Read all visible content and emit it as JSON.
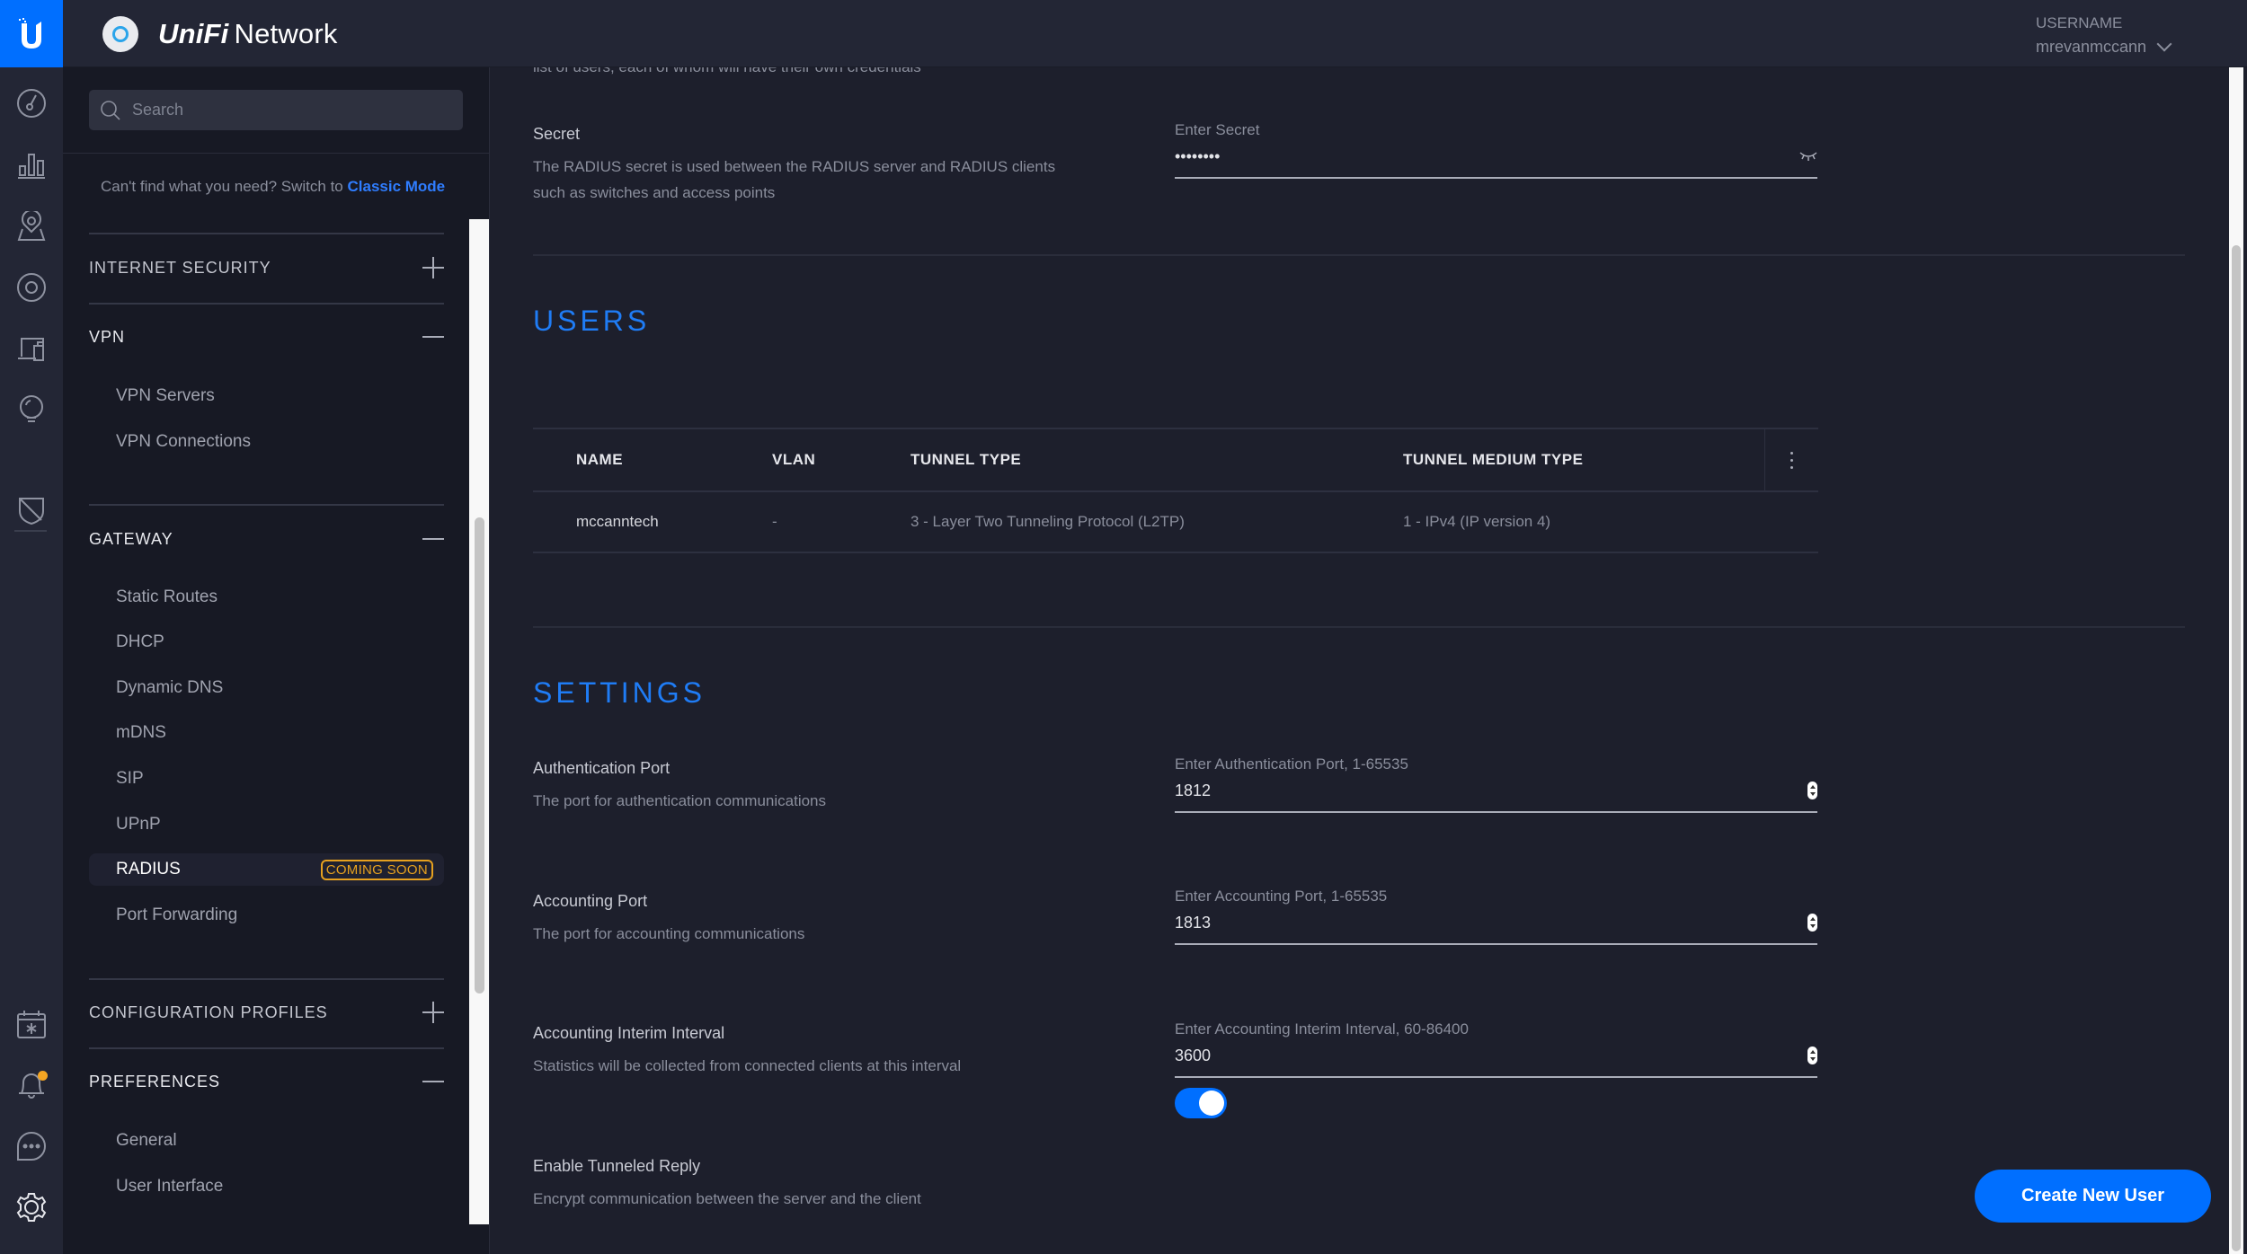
{
  "header": {
    "app_name_brand": "UniFi",
    "app_name_rest": "Network",
    "user_label": "USERNAME",
    "username": "mrevanmccann"
  },
  "rail": {
    "icons": [
      "dashboard-icon",
      "statistics-icon",
      "map-icon",
      "devices-icon",
      "clients-icon",
      "insights-icon",
      "threat-management-icon",
      "events-icon",
      "alerts-icon",
      "chat-icon",
      "settings-icon"
    ],
    "alert_dot_color": "#f5a623"
  },
  "sidebar": {
    "search_placeholder": "Search",
    "classic_prefix": "Can't find what you need? Switch to",
    "classic_link": "Classic Mode",
    "sections": [
      {
        "title": "INTERNET SECURITY",
        "state": "collapsed"
      },
      {
        "title": "VPN",
        "state": "expanded",
        "items": [
          "VPN Servers",
          "VPN Connections"
        ]
      },
      {
        "title": "GATEWAY",
        "state": "expanded",
        "items": [
          "Static Routes",
          "DHCP",
          "Dynamic DNS",
          "mDNS",
          "SIP",
          "UPnP",
          "RADIUS",
          "Port Forwarding"
        ]
      },
      {
        "title": "CONFIGURATION PROFILES",
        "state": "collapsed"
      },
      {
        "title": "PREFERENCES",
        "state": "expanded",
        "items": [
          "General",
          "User Interface"
        ]
      }
    ],
    "active_item": "RADIUS",
    "active_badge": "COMING SOON"
  },
  "main": {
    "cut_text": "list of users, each of whom will have their own credentials",
    "secret": {
      "label": "Secret",
      "description": "The RADIUS secret is used between the RADIUS server and RADIUS clients such as switches and access points",
      "placeholder": "Enter Secret",
      "value": "••••••••"
    },
    "users": {
      "title": "USERS",
      "columns": [
        "NAME",
        "VLAN",
        "TUNNEL TYPE",
        "TUNNEL MEDIUM TYPE"
      ],
      "rows": [
        {
          "name": "mccanntech",
          "vlan": "-",
          "tunnel_type": "3 - Layer Two Tunneling Protocol (L2TP)",
          "tunnel_medium_type": "1 - IPv4 (IP version 4)"
        }
      ]
    },
    "settings": {
      "title": "SETTINGS",
      "auth_port": {
        "label": "Authentication Port",
        "description": "The port for authentication communications",
        "placeholder": "Enter Authentication Port, 1-65535",
        "value": "1812"
      },
      "acct_port": {
        "label": "Accounting Port",
        "description": "The port for accounting communications",
        "placeholder": "Enter Accounting Port, 1-65535",
        "value": "1813"
      },
      "interim": {
        "label": "Accounting Interim Interval",
        "description": "Statistics will be collected from connected clients at this interval",
        "placeholder": "Enter Accounting Interim Interval, 60-86400",
        "value": "3600"
      },
      "tunneled_reply": {
        "label": "Enable Tunneled Reply",
        "description": "Encrypt communication between the server and the client",
        "enabled": true
      }
    },
    "create_button": "Create New User"
  },
  "colors": {
    "accent": "#006fff",
    "badge": "#e6a11f",
    "section_title": "#1f7cf5"
  }
}
